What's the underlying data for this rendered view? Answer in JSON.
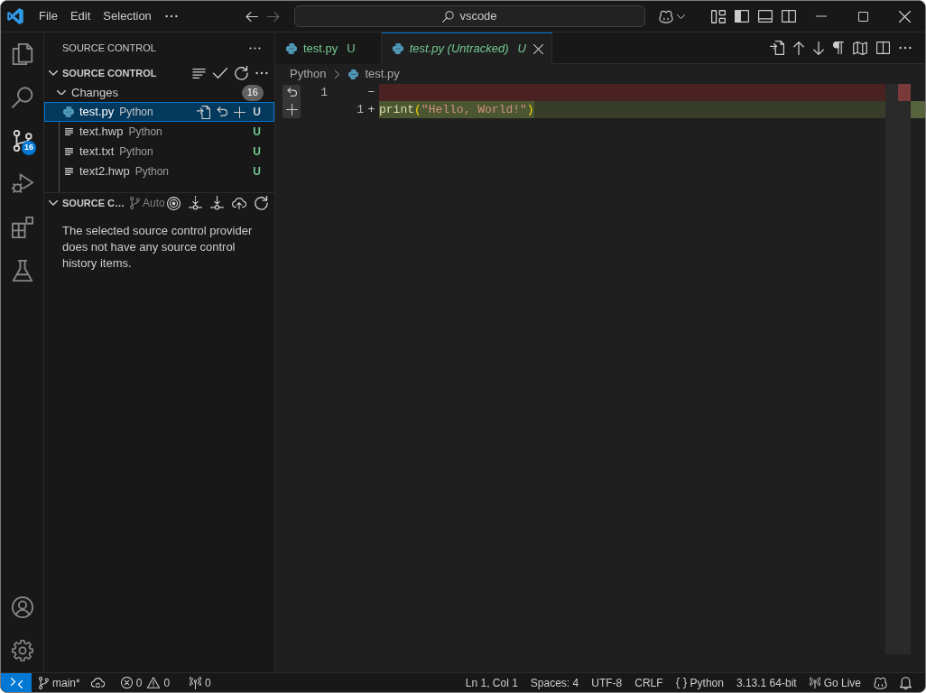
{
  "title_bar": {
    "menu": [
      "File",
      "Edit",
      "Selection"
    ],
    "navigation": [
      {
        "kind": "back",
        "disabled": false
      },
      {
        "kind": "forward",
        "disabled": true
      }
    ],
    "command_center": "vscode"
  },
  "activity_bar": {
    "items": [
      {
        "kind": "explorer",
        "selected": false
      },
      {
        "kind": "search",
        "selected": false
      },
      {
        "kind": "source_control",
        "selected": true,
        "badge": "16"
      },
      {
        "kind": "run_debug",
        "selected": false
      },
      {
        "kind": "extensions",
        "selected": false
      },
      {
        "kind": "testing",
        "selected": false
      }
    ],
    "bottom": [
      {
        "kind": "accounts"
      },
      {
        "kind": "settings"
      }
    ]
  },
  "sidebar": {
    "title": "SOURCE CONTROL",
    "repository": {
      "title": "SOURCE CONTROL",
      "expanded": true
    },
    "changes": {
      "label": "Changes",
      "count": "16",
      "expanded": true
    },
    "files": [
      {
        "name": "test.py",
        "description": "Python",
        "status": "U",
        "kind": "python",
        "selected": true
      },
      {
        "name": "text.hwp",
        "description": "Python",
        "status": "U",
        "kind": "text",
        "selected": false
      },
      {
        "name": "text.txt",
        "description": "Python",
        "status": "U",
        "kind": "text",
        "selected": false
      },
      {
        "name": "text2.hwp",
        "description": "Python",
        "status": "U",
        "kind": "text",
        "selected": false
      }
    ],
    "graph": {
      "title": "SOURCE C…",
      "expanded": true,
      "ref_filter": "Auto",
      "message": "The selected source control provider does not have any source control history items."
    }
  },
  "editor": {
    "tabs": [
      {
        "label": "test.py",
        "status": "U",
        "selected": false,
        "preview": false
      },
      {
        "label": "test.py (Untracked)",
        "status": "U",
        "selected": true,
        "preview": true
      }
    ],
    "breadcrumbs": [
      {
        "label": "Python",
        "kind": "folder"
      },
      {
        "label": "test.py",
        "kind": "python"
      }
    ],
    "diff_lines": [
      {
        "kind": "removed",
        "original_number": "1",
        "marker": "−"
      },
      {
        "kind": "added",
        "modified_number": "1",
        "marker": "+",
        "tokens": [
          {
            "text": "print",
            "kind": "function"
          },
          {
            "text": "(",
            "kind": "bracket"
          },
          {
            "text": "\"Hello, World!\"",
            "kind": "string"
          },
          {
            "text": ")",
            "kind": "bracket"
          }
        ]
      }
    ]
  },
  "status_bar": {
    "left": [
      {
        "kind": "remote"
      },
      {
        "kind": "branch",
        "text": "main*"
      },
      {
        "kind": "sync"
      },
      {
        "kind": "problems",
        "errors": "0",
        "warnings": "0"
      },
      {
        "kind": "ports",
        "text": "0"
      }
    ],
    "right": [
      {
        "kind": "cursor_position",
        "text": "Ln 1, Col 1"
      },
      {
        "kind": "indentation",
        "text": "Spaces: 4"
      },
      {
        "kind": "encoding",
        "text": "UTF-8"
      },
      {
        "kind": "line_ending",
        "text": "CRLF"
      },
      {
        "kind": "language",
        "text": "Python"
      },
      {
        "kind": "interpreter",
        "text": "3.13.1 64-bit"
      },
      {
        "kind": "go_live",
        "text": "Go Live"
      },
      {
        "kind": "copilot"
      },
      {
        "kind": "notifications"
      }
    ]
  }
}
